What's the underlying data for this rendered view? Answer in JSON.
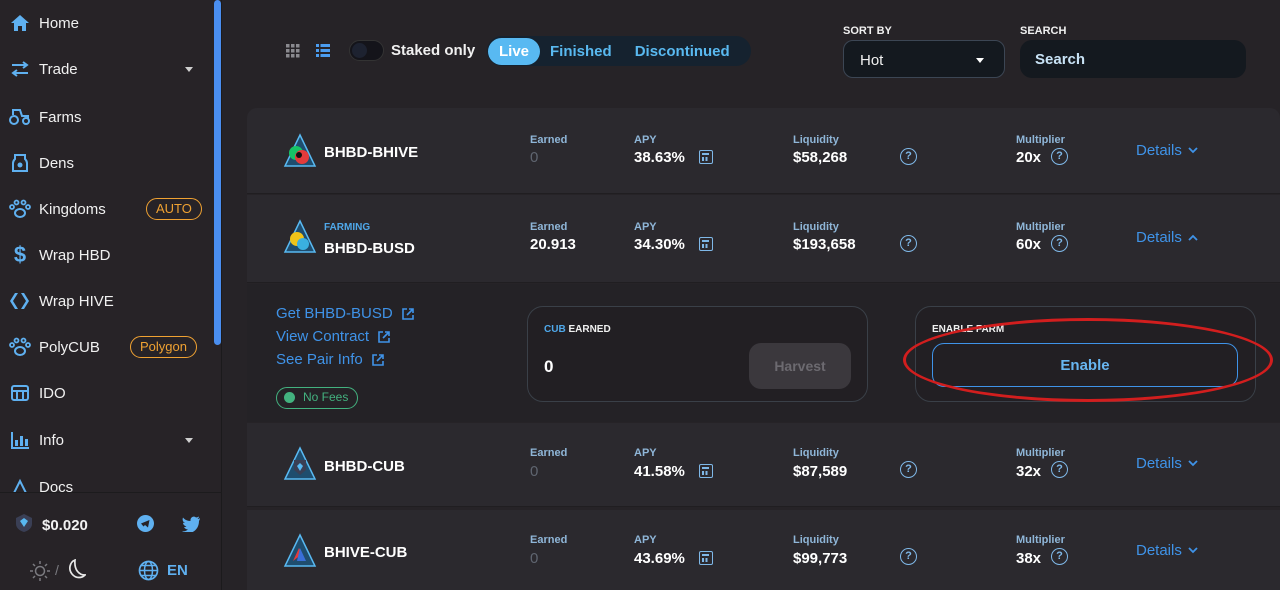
{
  "sidebar": {
    "items": [
      {
        "label": "Home",
        "icon": "home-icon"
      },
      {
        "label": "Trade",
        "icon": "swap-icon"
      },
      {
        "label": "Farms",
        "icon": "tractor-icon"
      },
      {
        "label": "Dens",
        "icon": "den-icon"
      },
      {
        "label": "Kingdoms",
        "icon": "paw-icon",
        "badge": "AUTO"
      },
      {
        "label": "Wrap HBD",
        "icon": "dollar-icon"
      },
      {
        "label": "Wrap HIVE",
        "icon": "hive-icon"
      },
      {
        "label": "PolyCUB",
        "icon": "paw-icon",
        "badge": "Polygon"
      },
      {
        "label": "IDO",
        "icon": "ido-icon"
      },
      {
        "label": "Info",
        "icon": "chart-icon"
      },
      {
        "label": "Docs",
        "icon": "docs-icon"
      }
    ],
    "price": "$0.020",
    "language": "EN",
    "theme_separator": "/"
  },
  "controls": {
    "staked_only": "Staked only",
    "tabs": [
      "Live",
      "Finished",
      "Discontinued"
    ],
    "active_tab": "Live",
    "sort_by_label": "SORT BY",
    "sort_value": "Hot",
    "search_label": "SEARCH",
    "search_placeholder": "Search"
  },
  "labels": {
    "earned": "Earned",
    "apy": "APY",
    "liquidity": "Liquidity",
    "multiplier": "Multiplier",
    "details": "Details",
    "farming": "FARMING"
  },
  "farms": [
    {
      "pair": "BHBD-BHIVE",
      "earned": "0",
      "apy": "38.63%",
      "liquidity": "$58,268",
      "multiplier": "20x"
    },
    {
      "pair": "BHBD-BUSD",
      "earned": "20.913",
      "apy": "34.30%",
      "liquidity": "$193,658",
      "multiplier": "60x",
      "farming": true
    },
    {
      "pair": "BHBD-CUB",
      "earned": "0",
      "apy": "41.58%",
      "liquidity": "$87,589",
      "multiplier": "32x"
    },
    {
      "pair": "BHIVE-CUB",
      "earned": "0",
      "apy": "43.69%",
      "liquidity": "$99,773",
      "multiplier": "38x"
    }
  ],
  "expanded": {
    "links": [
      "Get BHBD-BUSD",
      "View Contract",
      "See Pair Info"
    ],
    "no_fees": "No Fees",
    "cub_earned_prefix": "CUB",
    "cub_earned_suffix": "EARNED",
    "cub_earned_value": "0",
    "harvest": "Harvest",
    "enable_farm_label": "ENABLE FARM",
    "enable": "Enable"
  },
  "colors": {
    "accent": "#3f93e8",
    "badge": "#f0a232",
    "annotation": "#d21e1e"
  }
}
